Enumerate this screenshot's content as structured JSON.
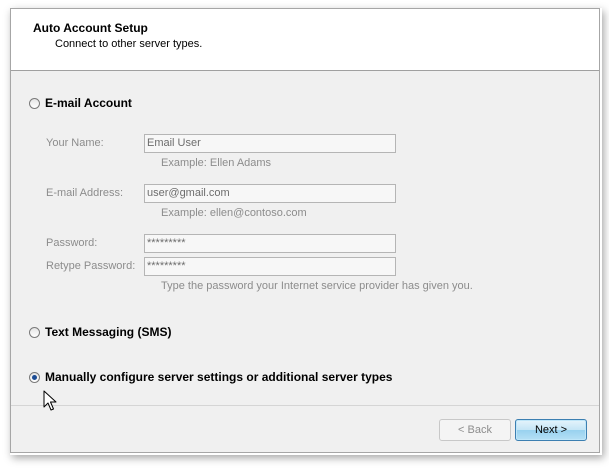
{
  "header": {
    "title": "Auto Account Setup",
    "subtitle": "Connect to other server types."
  },
  "options": {
    "email_account": "E-mail Account",
    "text_messaging": "Text Messaging (SMS)",
    "manual": "Manually configure server settings or additional server types",
    "selected": "manual"
  },
  "fields": {
    "name_label": "Your Name:",
    "name_value": "Email User",
    "name_hint": "Example: Ellen Adams",
    "email_label": "E-mail Address:",
    "email_value": "user@gmail.com",
    "email_hint": "Example: ellen@contoso.com",
    "password_label": "Password:",
    "password_value": "*********",
    "retype_label": "Retype Password:",
    "retype_value": "*********",
    "password_hint": "Type the password your Internet service provider has given you."
  },
  "buttons": {
    "back": "< Back",
    "next": "Next >"
  },
  "icons": {
    "cursor": "arrow-cursor-icon"
  }
}
